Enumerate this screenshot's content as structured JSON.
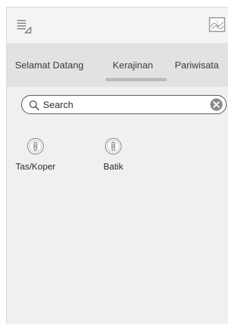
{
  "header": {
    "menu_icon": "list-menu-icon",
    "map_icon": "map-icon"
  },
  "tabs": [
    {
      "label": "Selamat Datang",
      "active": false
    },
    {
      "label": "Kerajinan",
      "active": true
    },
    {
      "label": "Pariwisata",
      "active": false
    }
  ],
  "search": {
    "placeholder": "Search",
    "value": ""
  },
  "categories": [
    {
      "label": "Tas/Koper",
      "icon": "info-pin-icon"
    },
    {
      "label": "Batik",
      "icon": "info-pin-icon"
    }
  ],
  "colors": {
    "background": "#f0f0f0",
    "tab_bar": "#e2e2e2",
    "tab_indicator": "#bcbcbc"
  }
}
